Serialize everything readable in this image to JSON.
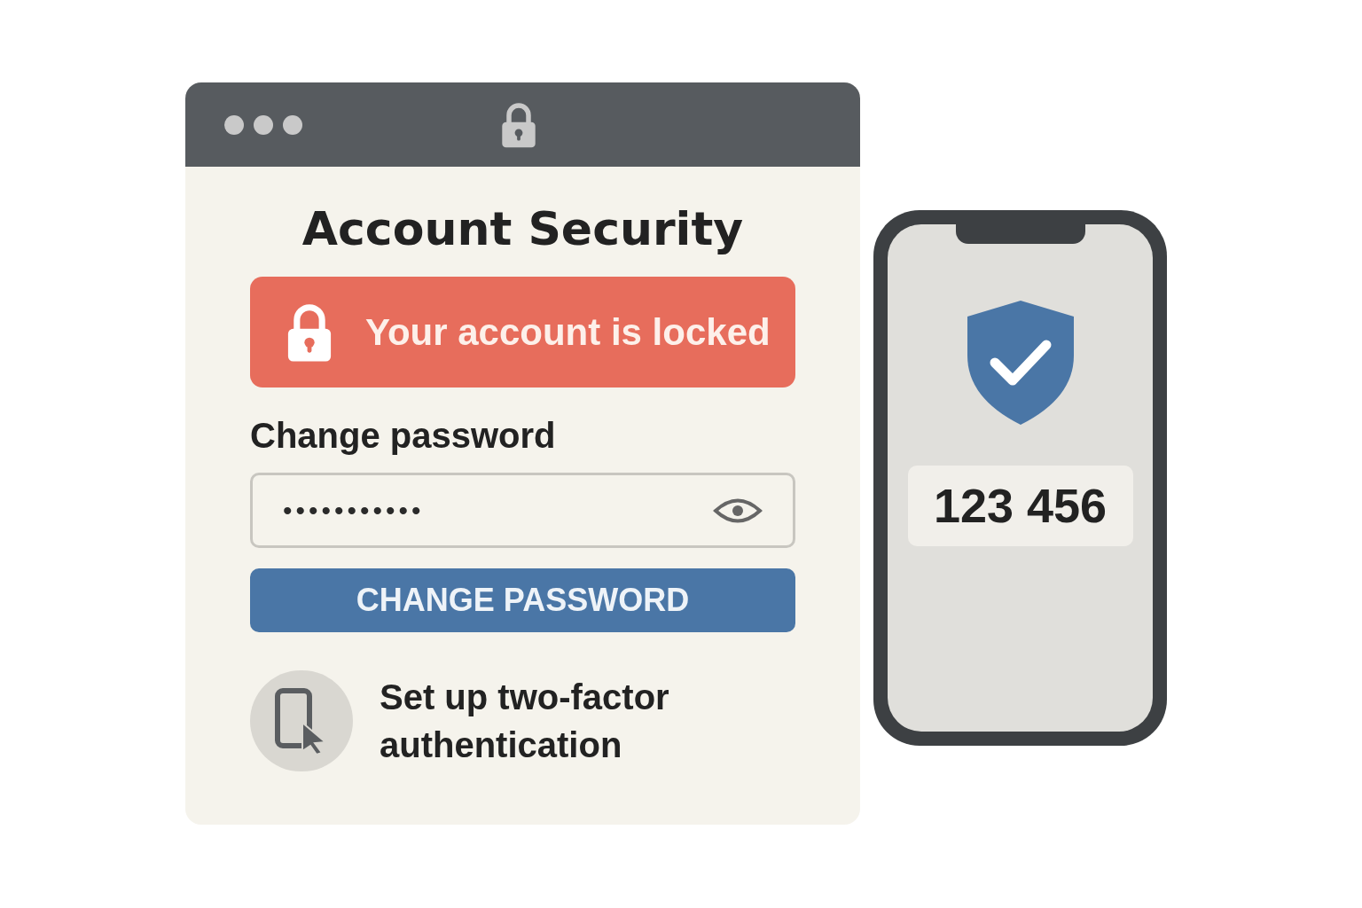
{
  "heading": "Account Security",
  "alert": {
    "text": "Your account is locked"
  },
  "password": {
    "label": "Change password",
    "value": "•••••••••••"
  },
  "button": {
    "label": "CHANGE PASSWORD"
  },
  "two_factor": {
    "text": "Set up two-factor authentication"
  },
  "phone": {
    "code": "123 456"
  }
}
